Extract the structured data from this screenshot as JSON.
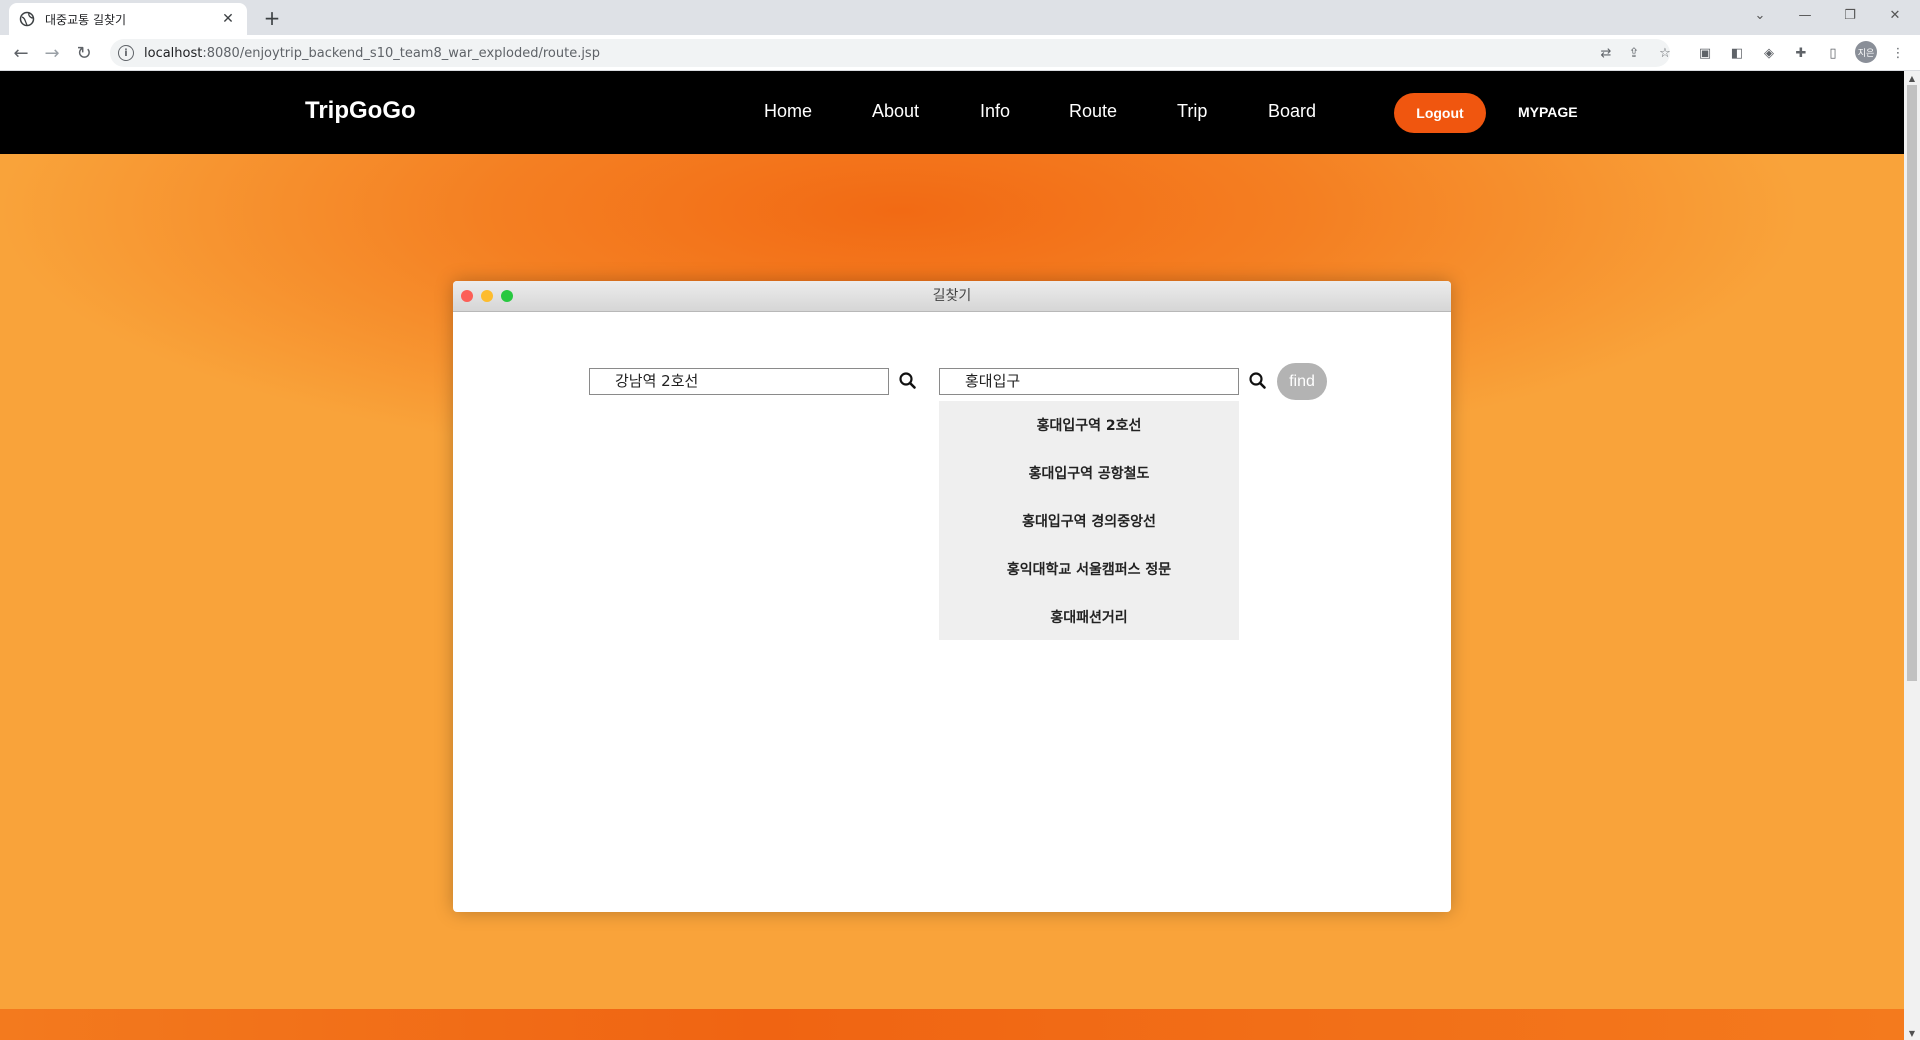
{
  "browser": {
    "tab_title": "대중교통 길찾기",
    "tab_close": "✕",
    "new_tab": "+",
    "url_host": "localhost",
    "url_path": ":8080/enjoytrip_backend_s10_team8_war_exploded/route.jsp",
    "profile_initials": "지은"
  },
  "navbar": {
    "brand": "TripGoGo",
    "links": [
      "Home",
      "About",
      "Info",
      "Route",
      "Trip",
      "Board"
    ],
    "logout_label": "Logout",
    "mypage_label": "MYPAGE"
  },
  "route_window": {
    "title": "길찾기",
    "start_value": "강남역 2호선",
    "end_value": "홍대입구",
    "find_label": "find",
    "suggestions": [
      "홍대입구역 2호선",
      "홍대입구역 공항철도",
      "홍대입구역 경의중앙선",
      "홍익대학교 서울캠퍼스 정문",
      "홍대패션거리"
    ]
  },
  "colors": {
    "accent": "#f0560f",
    "navbar_bg": "#000000",
    "find_button": "#b3b3b3",
    "dropdown_bg": "#efefef"
  },
  "icons": {
    "favicon": "globe-icon",
    "search": "magnifier-icon"
  }
}
